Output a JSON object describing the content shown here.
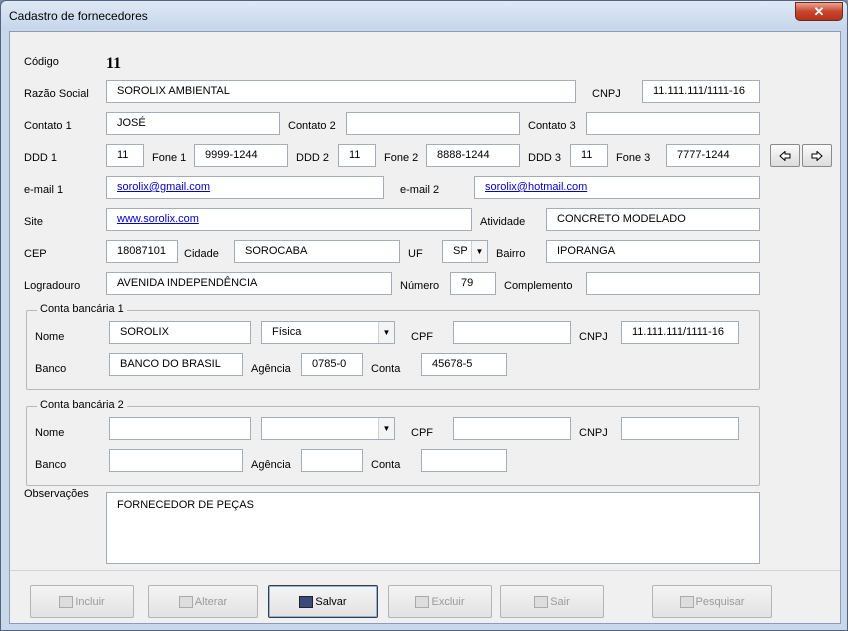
{
  "window": {
    "title": "Cadastro de fornecedores",
    "close_glyph": "✕"
  },
  "labels": {
    "codigo": "Código",
    "razao": "Razão Social",
    "cnpj": "CNPJ",
    "contato1": "Contato 1",
    "contato2": "Contato 2",
    "contato3": "Contato 3",
    "ddd1": "DDD 1",
    "fone1": "Fone 1",
    "ddd2": "DDD 2",
    "fone2": "Fone 2",
    "ddd3": "DDD 3",
    "fone3": "Fone 3",
    "email1": "e-mail 1",
    "email2": "e-mail 2",
    "site": "Site",
    "atividade": "Atividade",
    "cep": "CEP",
    "cidade": "Cidade",
    "uf": "UF",
    "bairro": "Bairro",
    "logradouro": "Logradouro",
    "numero": "Número",
    "complemento": "Complemento",
    "observacoes": "Observações"
  },
  "values": {
    "codigo": "11",
    "razao": "SOROLIX AMBIENTAL",
    "cnpj": "11.111.111/1111-16",
    "contato1": "JOSÉ",
    "contato2": "",
    "contato3": "",
    "ddd1": "11",
    "fone1": "9999-1244",
    "ddd2": "11",
    "fone2": "8888-1244",
    "ddd3": "11",
    "fone3": "7777-1244",
    "email1": "sorolix@gmail.com",
    "email2": "sorolix@hotmail.com",
    "site": "www.sorolix.com",
    "atividade": "CONCRETO MODELADO",
    "cep": "18087101",
    "cidade": "SOROCABA",
    "uf": "SP",
    "bairro": "IPORANGA",
    "logradouro": "AVENIDA INDEPENDÊNCIA",
    "numero": "79",
    "complemento": "",
    "observacoes": "FORNECEDOR DE PEÇAS"
  },
  "bank1": {
    "title": "Conta bancária 1",
    "labels": {
      "nome": "Nome",
      "cpf": "CPF",
      "cnpj": "CNPJ",
      "banco": "Banco",
      "agencia": "Agência",
      "conta": "Conta"
    },
    "values": {
      "nome": "SOROLIX",
      "tipo": "Física",
      "cpf": "",
      "cnpj": "11.111.111/1111-16",
      "banco": "BANCO DO BRASIL",
      "agencia": "0785-0",
      "conta": "45678-5"
    }
  },
  "bank2": {
    "title": "Conta bancária 2",
    "labels": {
      "nome": "Nome",
      "cpf": "CPF",
      "cnpj": "CNPJ",
      "banco": "Banco",
      "agencia": "Agência",
      "conta": "Conta"
    },
    "values": {
      "nome": "",
      "tipo": "",
      "cpf": "",
      "cnpj": "",
      "banco": "",
      "agencia": "",
      "conta": ""
    }
  },
  "buttons": {
    "incluir": "Incluir",
    "alterar": "Alterar",
    "salvar": "Salvar",
    "excluir": "Excluir",
    "sair": "Sair",
    "pesquisar": "Pesquisar"
  },
  "icons": {
    "prev": "arrow-left-icon",
    "next": "arrow-right-icon",
    "dropdown": "chevron-down-icon"
  }
}
